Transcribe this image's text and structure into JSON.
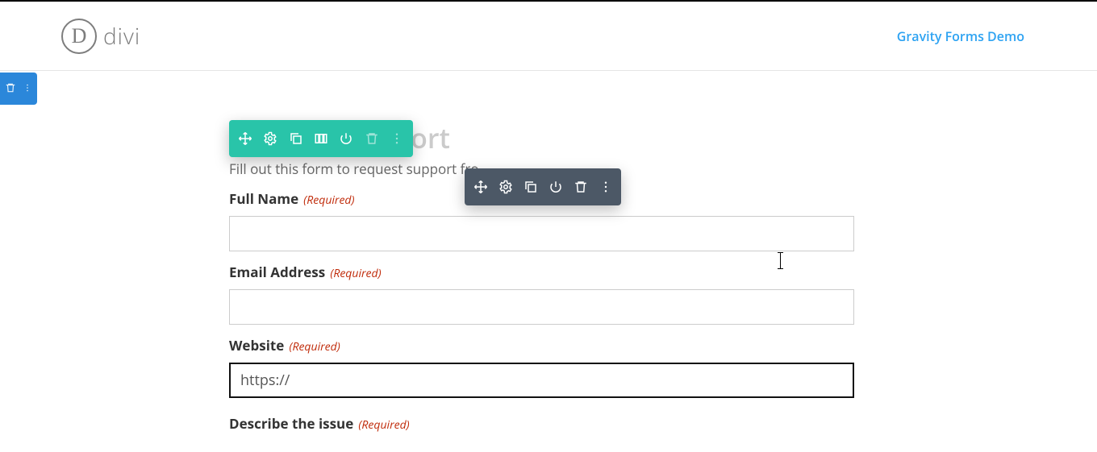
{
  "brand": {
    "mark": "D",
    "name": "divi"
  },
  "header": {
    "link_text": "Gravity Forms Demo"
  },
  "page": {
    "title": "Request Support",
    "description_prefix": "Fill out this form to request support fro"
  },
  "fields": {
    "full_name": {
      "label": "Full Name",
      "required": "(Required)",
      "value": ""
    },
    "email": {
      "label": "Email Address",
      "required": "(Required)",
      "value": ""
    },
    "website": {
      "label": "Website",
      "required": "(Required)",
      "value": "https://"
    },
    "describe": {
      "label": "Describe the issue",
      "required": "(Required)"
    }
  },
  "toolbar_icons": {
    "move": "move-icon",
    "settings": "gear-icon",
    "duplicate": "duplicate-icon",
    "columns": "columns-icon",
    "power": "power-icon",
    "trash": "trash-icon",
    "more": "more-icon"
  }
}
